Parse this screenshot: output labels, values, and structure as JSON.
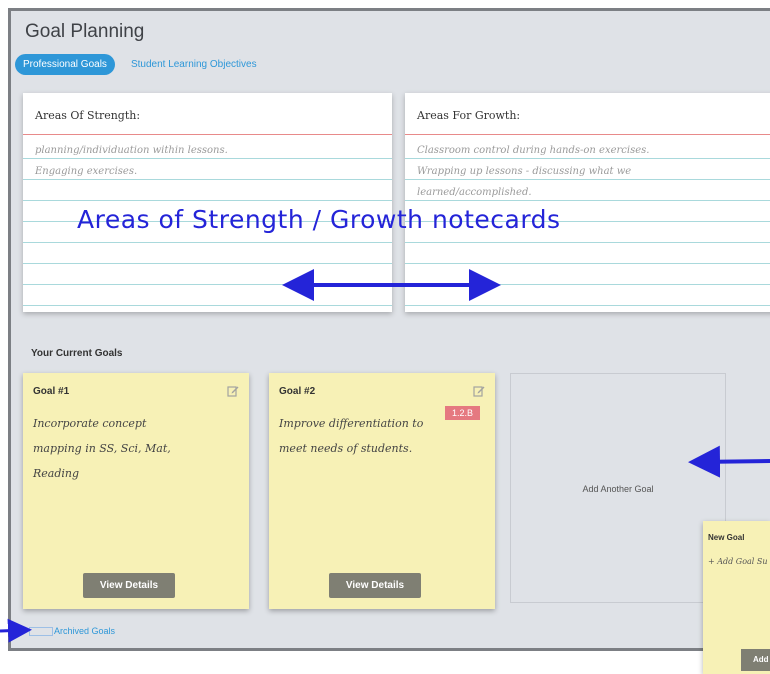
{
  "header": {
    "title": "Goal Planning"
  },
  "tabs": [
    {
      "label": "Professional Goals",
      "active": true
    },
    {
      "label": "Student Learning Objectives",
      "active": false
    }
  ],
  "notecards": {
    "strength": {
      "heading": "Areas Of Strength:",
      "lines": [
        "planning/individuation within lessons.",
        "Engaging exercises."
      ]
    },
    "growth": {
      "heading": "Areas For Growth:",
      "lines": [
        "Classroom control during hands-on exercises.",
        "Wrapping up lessons - discussing what we",
        "learned/accomplished."
      ]
    }
  },
  "annotation": {
    "notecards_label": "Areas of Strength / Growth notecards"
  },
  "goals_section": {
    "title": "Your Current Goals"
  },
  "goals": [
    {
      "title": "Goal #1",
      "text": [
        "Incorporate concept",
        "mapping in SS, Sci, Mat,",
        "Reading"
      ],
      "badge": "",
      "button": "View Details"
    },
    {
      "title": "Goal #2",
      "text": [
        "Improve differentiation to",
        "meet needs of students."
      ],
      "badge": "1.2.B",
      "button": "View Details"
    }
  ],
  "add_goal": {
    "label": "Add Another Goal"
  },
  "archived": {
    "label": "Archived Goals"
  },
  "new_goal_popup": {
    "title": "New Goal",
    "placeholder": "+ Add Goal Su",
    "button": "Add"
  },
  "colors": {
    "accent": "#2e97d8",
    "annotation": "#2424d8",
    "sticky": "#f7f1b6",
    "badge": "#e57980"
  }
}
